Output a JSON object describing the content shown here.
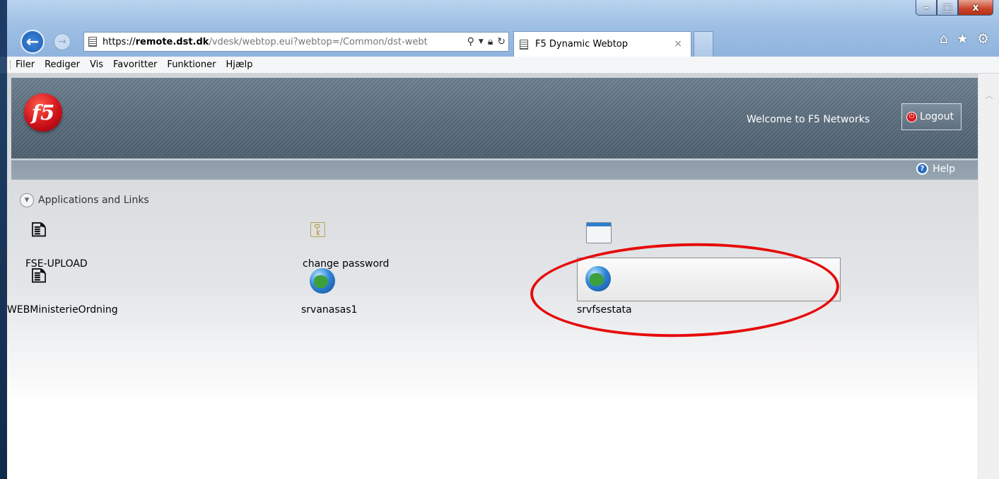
{
  "browser": {
    "url_scheme": "https://",
    "url_domain": "remote.dst.dk",
    "url_path": "/vdesk/webtop.eui?webtop=/Common/dst-webt",
    "tab_title": "F5 Dynamic Webtop",
    "tab_close": "×",
    "window_buttons": {
      "minimize": "–",
      "maximize": "□",
      "close": "x"
    },
    "icons": [
      "home-icon",
      "favorites-star-icon",
      "tools-gear-icon"
    ]
  },
  "menubar": {
    "items": [
      {
        "label": "Filer"
      },
      {
        "label": "Rediger"
      },
      {
        "label": "Vis"
      },
      {
        "label": "Favoritter"
      },
      {
        "label": "Funktioner"
      },
      {
        "label": "Hjælp"
      }
    ]
  },
  "header": {
    "logo_text": "f5",
    "welcome_text": "Welcome to F5 Networks",
    "logout_label": "Logout",
    "help_label": "Help"
  },
  "section": {
    "title": "Applications and Links"
  },
  "apps": [
    {
      "label": "FSE-UPLOAD",
      "icon": "document-upload-icon"
    },
    {
      "label": "change password",
      "icon": "keys-icon"
    },
    {
      "label": "",
      "icon": "window-icon"
    },
    {
      "label": "WEBMinisterieOrdning",
      "icon": "document-download-icon"
    },
    {
      "label": "srvanasas1",
      "icon": "globe-icon"
    },
    {
      "label": "srvfsestata",
      "icon": "globe-icon"
    }
  ],
  "colors": {
    "highlight_ellipse": "#e60b0b",
    "header_background": "#5a6c7c",
    "logo_red": "#d0121b"
  }
}
